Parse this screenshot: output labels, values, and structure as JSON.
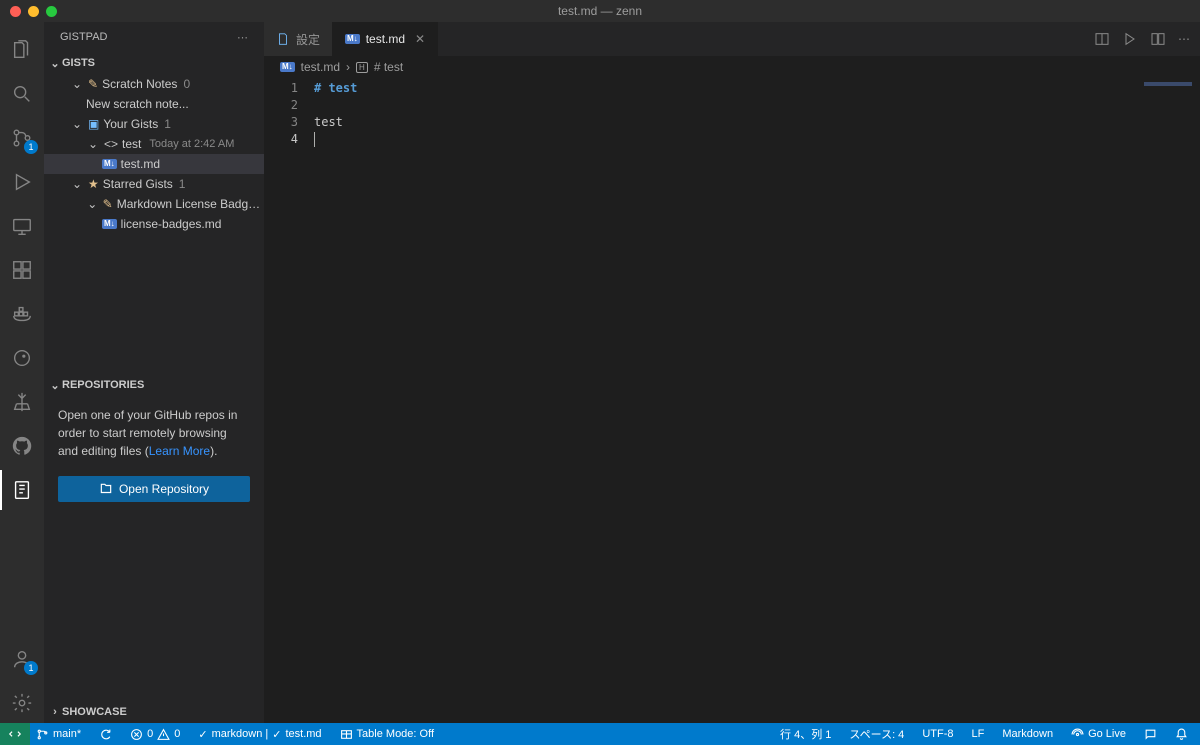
{
  "window": {
    "title": "test.md — zenn"
  },
  "sidebar": {
    "title": "GISTPAD",
    "sections": {
      "gists": {
        "label": "GISTS",
        "scratch": {
          "label": "Scratch Notes",
          "count": "0",
          "new_note": "New scratch note..."
        },
        "your": {
          "label": "Your Gists",
          "count": "1",
          "item": {
            "name": "test",
            "time": "Today at 2:42 AM",
            "file": "test.md"
          }
        },
        "starred": {
          "label": "Starred Gists",
          "count": "1",
          "item": {
            "name": "Markdown License Badges f…",
            "file": "license-badges.md"
          }
        }
      },
      "repositories": {
        "label": "REPOSITORIES",
        "message_pre": "Open one of your GitHub repos in order to start remotely browsing and editing files (",
        "link": "Learn More",
        "message_post": ").",
        "button": "Open Repository"
      },
      "showcase": {
        "label": "SHOWCASE"
      }
    }
  },
  "tabs": [
    {
      "label": "設定",
      "icon": "file-icon"
    },
    {
      "label": "test.md",
      "icon": "markdown-icon",
      "active": true,
      "close": true
    }
  ],
  "breadcrumb": {
    "file": "test.md",
    "symbol": "# test"
  },
  "editor": {
    "lines": [
      {
        "n": "1",
        "text": "# test",
        "kw": true
      },
      {
        "n": "2",
        "text": ""
      },
      {
        "n": "3",
        "text": "test"
      },
      {
        "n": "4",
        "text": ""
      }
    ]
  },
  "status": {
    "branch": "main*",
    "sync": "",
    "errors": "0",
    "warnings": "0",
    "prettier": "markdown |",
    "prettier_file": "test.md",
    "table_mode": "Table Mode: Off",
    "lncol": "行 4、列 1",
    "spaces": "スペース: 4",
    "encoding": "UTF-8",
    "eol": "LF",
    "lang": "Markdown",
    "golive": "Go Live"
  },
  "activity_badge_scm": "1",
  "activity_badge_accounts": "1"
}
